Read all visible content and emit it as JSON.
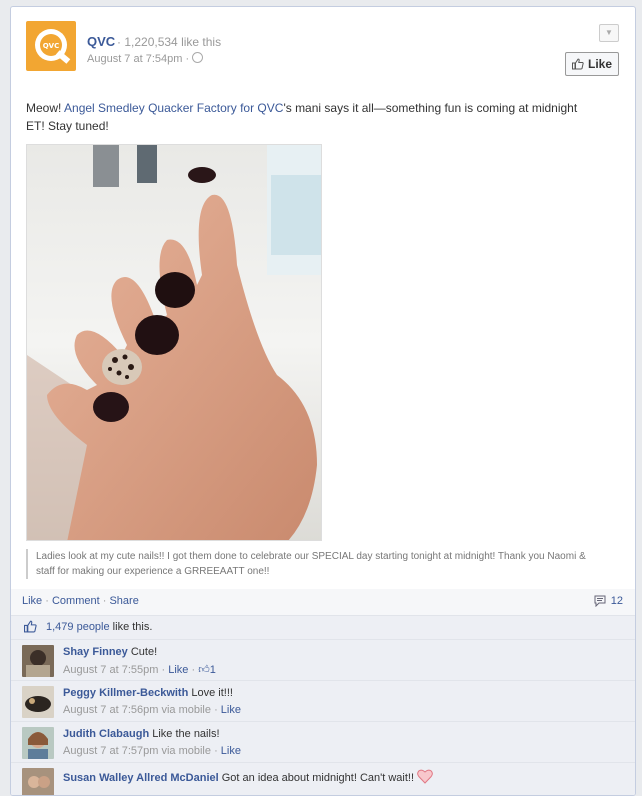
{
  "post": {
    "page_name": "QVC",
    "separator": "·",
    "likes_count": "1,220,534 like this",
    "timestamp": "August 7 at 7:54pm",
    "like_button": "Like",
    "text_prefix": "Meow! ",
    "text_link1": "Angel Smedley Quacker Factory for QVC",
    "text_suffix": "'s mani says it all—something fun is coming at midnight ET! Stay tuned!",
    "caption": "Ladies look at my cute nails!! I got them done to celebrate our SPECIAL day starting tonight at midnight! Thank you Naomi & staff for making our experience a GRREEAATT one!!",
    "logo_text": "QVC",
    "accent_color": "#f2a632",
    "link_color": "#3b5998"
  },
  "feedback": {
    "like_link": "Like",
    "comment_link": "Comment",
    "share_link": "Share",
    "comment_count": "12",
    "people_like": "1,479 people",
    "like_this": " like this."
  },
  "comments": [
    {
      "author": "Shay Finney",
      "text": "Cute!",
      "time": "August 7 at 7:55pm",
      "like": "Like",
      "like_count": "1",
      "via": ""
    },
    {
      "author": "Peggy Killmer-Beckwith",
      "text": "Love it!!!",
      "time": "August 7 at 7:56pm",
      "via": "via mobile",
      "like": "Like"
    },
    {
      "author": "Judith Clabaugh",
      "text": "Like the nails!",
      "time": "August 7 at 7:57pm",
      "via": "via mobile",
      "like": "Like"
    },
    {
      "author": "Susan Walley Allred McDaniel",
      "text": "Got an idea about midnight! Can't wait!!",
      "time": "",
      "via": "",
      "like": ""
    }
  ]
}
